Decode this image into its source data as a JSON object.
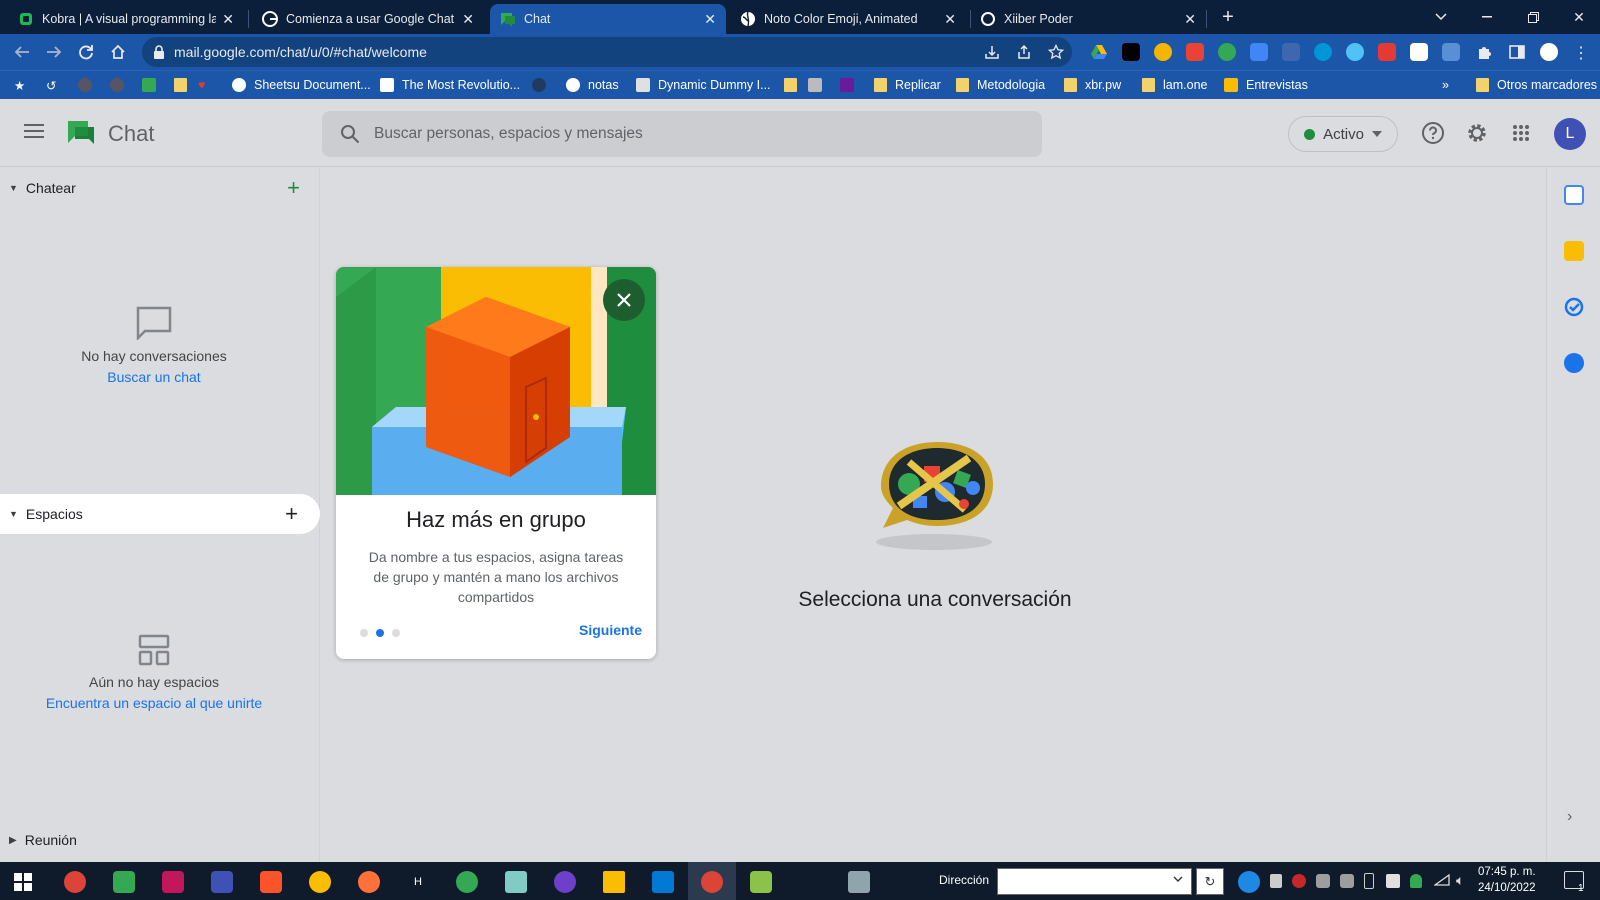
{
  "browser": {
    "tabs": [
      {
        "title": "Kobra | A visual programming lan",
        "icon": "kobra-icon",
        "color": "#1db954"
      },
      {
        "title": "Comienza a usar Google Chat - C",
        "icon": "google-icon",
        "color": "#ffffff"
      },
      {
        "title": "Chat",
        "icon": "google-chat-icon",
        "color": "#34a853"
      },
      {
        "title": "Noto Color Emoji, Animated",
        "icon": "globe-icon",
        "color": "#ffffff"
      },
      {
        "title": "Xiiber Poder",
        "icon": "circle-icon",
        "color": "#ffffff"
      }
    ],
    "url": "mail.google.com/chat/u/0/#chat/welcome",
    "bookmarks": [
      {
        "label": "Sheetsu Document...",
        "icon": "globe-icon"
      },
      {
        "label": "The Most Revolutio...",
        "icon": "page-icon"
      },
      {
        "label": "notas",
        "icon": "globe-icon"
      },
      {
        "label": "Dynamic Dummy I...",
        "icon": "x-icon"
      },
      {
        "label": "Replicar",
        "icon": "folder-icon"
      },
      {
        "label": "Metodologia",
        "icon": "folder-icon"
      },
      {
        "label": "xbr.pw",
        "icon": "folder-icon"
      },
      {
        "label": "lam.one",
        "icon": "folder-icon"
      },
      {
        "label": "Entrevistas",
        "icon": "drive-icon"
      }
    ],
    "other_bookmarks": "Otros marcadores",
    "overflow": "»"
  },
  "app": {
    "title": "Chat",
    "search_placeholder": "Buscar personas, espacios y mensajes",
    "status": "Activo",
    "avatar_initial": "L",
    "accent": "#1a73e8",
    "status_color": "#1e8e3e"
  },
  "sidebar": {
    "chat_section": {
      "label": "Chatear",
      "empty_text": "No hay conversaciones",
      "empty_link": "Buscar un chat"
    },
    "spaces_section": {
      "label": "Espacios",
      "empty_text": "Aún no hay espacios",
      "empty_link": "Encuentra un espacio al que unirte"
    },
    "meeting_section": {
      "label": "Reunión"
    }
  },
  "card": {
    "title": "Haz más en grupo",
    "description": "Da nombre a tus espacios, asigna tareas de grupo y mantén a mano los archivos compartidos",
    "next": "Siguiente",
    "page": 2,
    "pages": 3
  },
  "main": {
    "welcome": "Selecciona una conversación"
  },
  "taskbar": {
    "address_label": "Dirección",
    "time": "07:45 p. m.",
    "date": "24/10/2022",
    "notifications": "1"
  }
}
